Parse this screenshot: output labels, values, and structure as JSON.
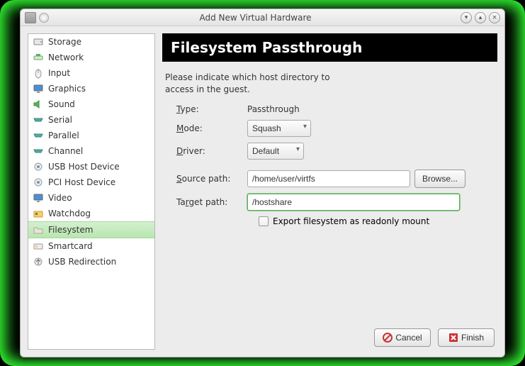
{
  "window": {
    "title": "Add New Virtual Hardware"
  },
  "sidebar": {
    "items": [
      {
        "label": "Storage"
      },
      {
        "label": "Network"
      },
      {
        "label": "Input"
      },
      {
        "label": "Graphics"
      },
      {
        "label": "Sound"
      },
      {
        "label": "Serial"
      },
      {
        "label": "Parallel"
      },
      {
        "label": "Channel"
      },
      {
        "label": "USB Host Device"
      },
      {
        "label": "PCI Host Device"
      },
      {
        "label": "Video"
      },
      {
        "label": "Watchdog"
      },
      {
        "label": "Filesystem"
      },
      {
        "label": "Smartcard"
      },
      {
        "label": "USB Redirection"
      }
    ],
    "selected_index": 12
  },
  "header": {
    "title": "Filesystem Passthrough"
  },
  "intro": {
    "line1": "Please indicate which host directory to",
    "line2": "access in the guest."
  },
  "form": {
    "type_label": "Type:",
    "type_value": "Passthrough",
    "mode_label": "Mode:",
    "mode_value": "Squash",
    "driver_label": "Driver:",
    "driver_value": "Default",
    "source_label": "Source path:",
    "source_value": "/home/user/virtfs",
    "browse_label": "Browse...",
    "target_label": "Target path:",
    "target_value": "/hostshare",
    "export_label": "Export filesystem as readonly mount"
  },
  "footer": {
    "cancel": "Cancel",
    "finish": "Finish"
  }
}
